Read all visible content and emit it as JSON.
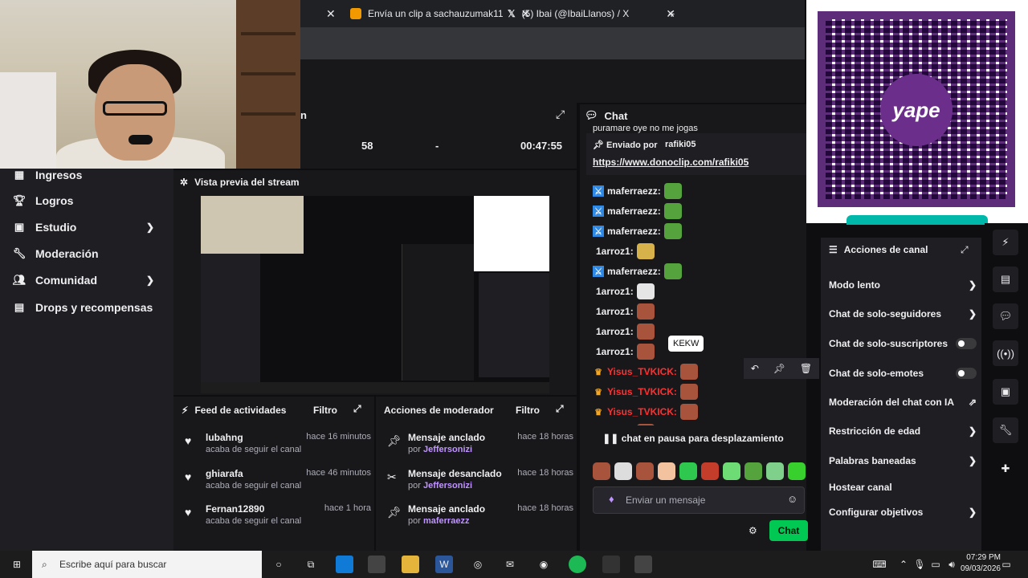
{
  "browser": {
    "tabs": [
      {
        "title": "Envía un clip a sachauzumak11",
        "icon": "clip-icon"
      },
      {
        "title": "(5) Ibai (@IbaiLlanos) / X",
        "icon": "x-icon"
      }
    ],
    "new_tab": "+"
  },
  "stats": {
    "followers": "58",
    "dash": "-",
    "time": "00:47:55"
  },
  "sidebar": {
    "items": [
      {
        "label": "Ingresos"
      },
      {
        "label": "Logros"
      },
      {
        "label": "Estudio"
      },
      {
        "label": "Moderación"
      },
      {
        "label": "Comunidad"
      },
      {
        "label": "Drops y recompensas"
      }
    ]
  },
  "preview": {
    "title": "Vista previa del stream"
  },
  "activity_feed": {
    "title": "Feed de actividades",
    "filter": "Filtro",
    "items": [
      {
        "name": "lubahng",
        "action": "acaba de seguir el canal",
        "time": "hace 16 minutos"
      },
      {
        "name": "ghiarafa",
        "action": "acaba de seguir el canal",
        "time": "hace 46 minutos"
      },
      {
        "name": "Fernan12890",
        "action": "acaba de seguir el canal",
        "time": "hace 1 hora"
      }
    ]
  },
  "mod_actions": {
    "title": "Acciones de moderador",
    "filter": "Filtro",
    "items": [
      {
        "action": "Mensaje anclado",
        "by_prefix": "por",
        "by": "Jeffersonizi",
        "time": "hace 18 horas"
      },
      {
        "action": "Mensaje desanclado",
        "by_prefix": "por",
        "by": "Jeffersonizi",
        "time": "hace 18 horas"
      },
      {
        "action": "Mensaje anclado",
        "by_prefix": "por",
        "by": "maferraezz",
        "time": "hace 18 horas"
      }
    ]
  },
  "chat": {
    "title": "Chat",
    "pinned_label": "Enviado por",
    "pinned_user": "rafiki05",
    "pinned_link": "https://www.donoclip.com/rafiki05",
    "top_text": "puramare oye no me jogas",
    "messages": [
      {
        "user": "maferraezz",
        "emote": "frog"
      },
      {
        "user": "maferraezz",
        "emote": "frog"
      },
      {
        "user": "maferraezz",
        "emote": "frog"
      },
      {
        "user": "1arroz1",
        "emote": "hands"
      },
      {
        "user": "maferraezz",
        "emote": "frog"
      },
      {
        "user": "1arroz1",
        "emote": "skull"
      },
      {
        "user": "1arroz1",
        "emote": "kek"
      },
      {
        "user": "1arroz1",
        "emote": "kek"
      },
      {
        "user": "1arroz1",
        "emote": "kek"
      },
      {
        "user": "Yisus_TVKICK",
        "emote": "kek"
      },
      {
        "user": "Yisus_TVKICK",
        "emote": "kek"
      },
      {
        "user": "Yisus_TVKICK",
        "emote": "kek"
      },
      {
        "user": "1arroz1",
        "emote": "kek"
      }
    ],
    "tooltip": "KEKW",
    "paused": "chat en pausa para desplazamiento",
    "placeholder": "Enviar un mensaje",
    "send": "Chat"
  },
  "qr": {
    "logo_text": "yape"
  },
  "channel_actions": {
    "title": "Acciones de canal",
    "items": [
      {
        "label": "Modo lento",
        "control": "chevron"
      },
      {
        "label": "Chat de solo-seguidores",
        "control": "chevron"
      },
      {
        "label": "Chat de solo-suscriptores",
        "control": "toggle"
      },
      {
        "label": "Chat de solo-emotes",
        "control": "toggle"
      },
      {
        "label": "Moderación del chat con IA",
        "control": "external"
      },
      {
        "label": "Restricción de edad",
        "control": "chevron"
      },
      {
        "label": "Palabras baneadas",
        "control": "chevron"
      },
      {
        "label": "Hostear canal",
        "control": "none"
      },
      {
        "label": "Configurar objetivos",
        "control": "chevron"
      }
    ]
  },
  "taskbar": {
    "search_placeholder": "Escribe aquí para buscar",
    "time": "07:29 PM",
    "date": "09/03/2026"
  },
  "colors": {
    "accent": "#9147ff",
    "send": "#00c853",
    "yape": "#5d2d7a",
    "user_red": "#ff2f2f",
    "user_blue": "#bf94ff"
  }
}
